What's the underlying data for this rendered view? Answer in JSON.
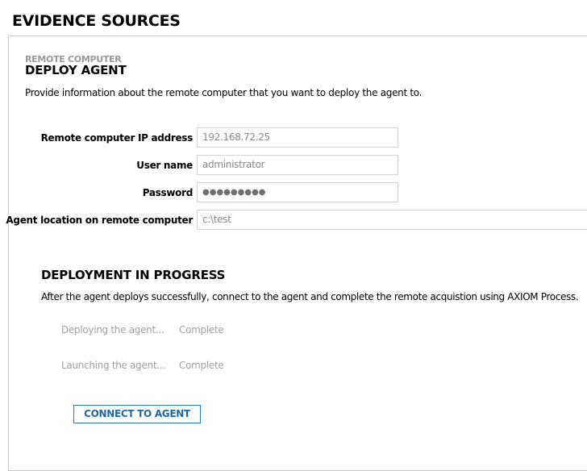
{
  "header": {
    "title": "EVIDENCE SOURCES"
  },
  "panel": {
    "subtitle": "REMOTE COMPUTER",
    "title": "DEPLOY AGENT",
    "description": "Provide information about the remote computer that you want to deploy the agent to.",
    "fields": [
      {
        "label": "Remote computer IP address",
        "value": "192.168.72.25"
      },
      {
        "label": "User name",
        "value": "administrator"
      },
      {
        "label": "Password",
        "value": "●●●●●●●●●"
      },
      {
        "label": "Agent location on remote computer",
        "value": "c:\\test"
      }
    ]
  },
  "progress": {
    "title": "DEPLOYMENT IN PROGRESS",
    "description": "After the agent deploys successfully, connect to the agent and complete the remote acquistion using AXIOM Process.",
    "steps": [
      {
        "label": "Deploying the agent...",
        "status": "Complete"
      },
      {
        "label": "Launching the agent...",
        "status": "Complete"
      }
    ],
    "connect_label": "CONNECT TO AGENT",
    "accent": "#1d68a8"
  }
}
